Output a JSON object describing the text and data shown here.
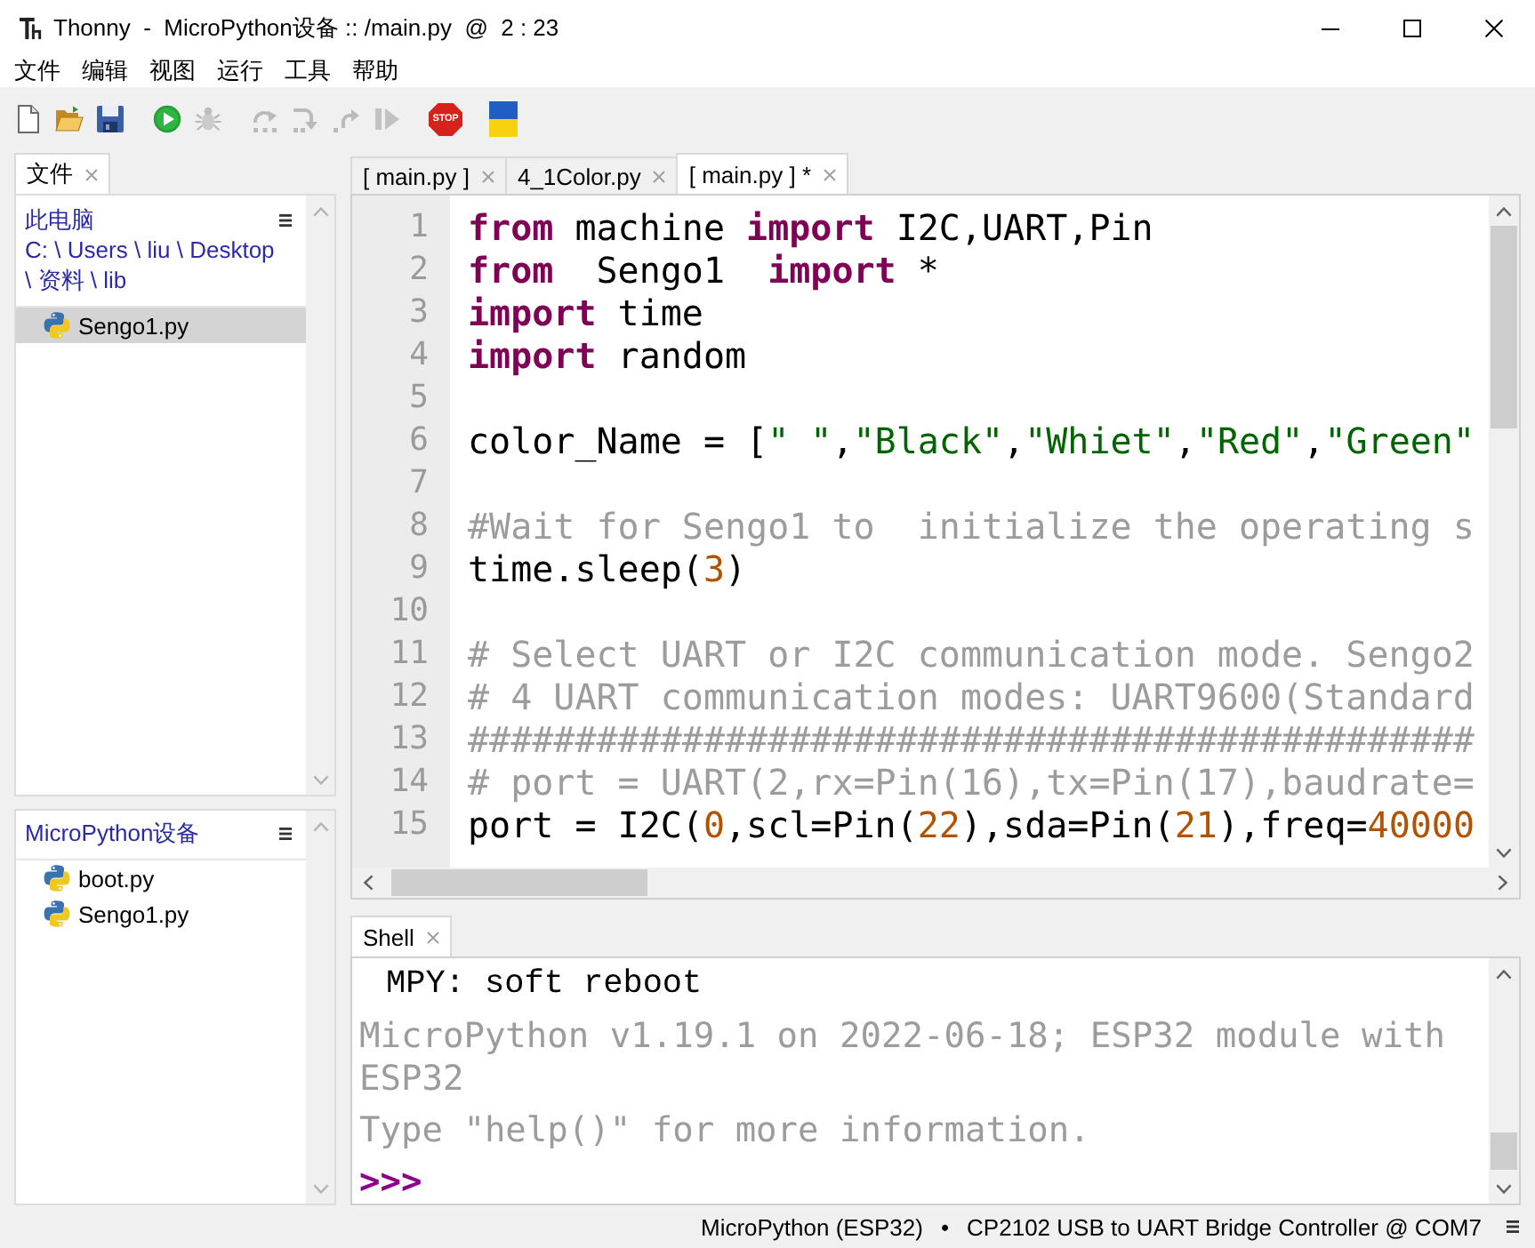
{
  "window": {
    "title": "Thonny  -  MicroPython设备 :: /main.py  @  2 : 23"
  },
  "menu": [
    "文件",
    "编辑",
    "视图",
    "运行",
    "工具",
    "帮助"
  ],
  "toolbar": [
    [
      {
        "kind": "new",
        "disabled": false
      },
      {
        "kind": "open",
        "disabled": false
      },
      {
        "kind": "save",
        "disabled": false
      }
    ],
    [
      {
        "kind": "run",
        "disabled": false
      },
      {
        "kind": "debug",
        "disabled": true
      }
    ],
    [
      {
        "kind": "step_over",
        "disabled": true
      },
      {
        "kind": "step_into",
        "disabled": true
      },
      {
        "kind": "step_out",
        "disabled": true
      },
      {
        "kind": "resume",
        "disabled": true
      }
    ],
    [
      {
        "kind": "stop",
        "label": "STOP",
        "disabled": false
      }
    ],
    [
      {
        "kind": "support",
        "disabled": false
      }
    ]
  ],
  "files_view": {
    "tab": {
      "label": "文件",
      "selected": true
    },
    "local": {
      "title": "此电脑",
      "path": [
        {
          "kind": "link",
          "text": "C:"
        },
        {
          "kind": "separator",
          "text": "\\"
        },
        {
          "kind": "link",
          "text": "Users"
        },
        {
          "kind": "separator",
          "text": "\\"
        },
        {
          "kind": "link",
          "text": "liu"
        },
        {
          "kind": "separator",
          "text": "\\"
        },
        {
          "kind": "link",
          "text": "Desktop"
        },
        {
          "kind": "separator",
          "text": "\\"
        },
        {
          "kind": "link",
          "text": "资料"
        },
        {
          "kind": "separator",
          "text": "\\"
        },
        {
          "kind": "link",
          "text": "lib"
        }
      ],
      "files": [
        {
          "name": "Sengo1.py",
          "selected": true
        }
      ]
    },
    "device": {
      "title": "MicroPython设备",
      "files": [
        {
          "name": "boot.py",
          "selected": false
        },
        {
          "name": "Sengo1.py",
          "selected": false
        }
      ]
    }
  },
  "editor": {
    "tabs": [
      {
        "label": "[ main.py ]",
        "selected": false
      },
      {
        "label": "4_1Color.py",
        "selected": false
      },
      {
        "label": "[ main.py ] *",
        "selected": true
      }
    ],
    "lines": [
      {
        "number": "1",
        "tokens": [
          {
            "kind": "keyword",
            "text": "from"
          },
          {
            "kind": "plain",
            "text": " machine "
          },
          {
            "kind": "keyword",
            "text": "import"
          },
          {
            "kind": "plain",
            "text": " I2C,UART,Pin"
          }
        ]
      },
      {
        "number": "2",
        "tokens": [
          {
            "kind": "keyword",
            "text": "from"
          },
          {
            "kind": "plain",
            "text": "  Sengo1  "
          },
          {
            "kind": "keyword",
            "text": "import"
          },
          {
            "kind": "plain",
            "text": " *"
          }
        ]
      },
      {
        "number": "3",
        "tokens": [
          {
            "kind": "keyword",
            "text": "import"
          },
          {
            "kind": "plain",
            "text": " time"
          }
        ]
      },
      {
        "number": "4",
        "tokens": [
          {
            "kind": "keyword",
            "text": "import"
          },
          {
            "kind": "plain",
            "text": " random"
          }
        ]
      },
      {
        "number": "5"
      },
      {
        "number": "6",
        "tokens": [
          {
            "kind": "plain",
            "text": "color_Name = ["
          },
          {
            "kind": "string",
            "text": "\" \""
          },
          {
            "kind": "plain",
            "text": ","
          },
          {
            "kind": "string",
            "text": "\"Black\""
          },
          {
            "kind": "plain",
            "text": ","
          },
          {
            "kind": "string",
            "text": "\"Whiet\""
          },
          {
            "kind": "plain",
            "text": ","
          },
          {
            "kind": "string",
            "text": "\"Red\""
          },
          {
            "kind": "plain",
            "text": ","
          },
          {
            "kind": "string",
            "text": "\"Green\""
          }
        ]
      },
      {
        "number": "7"
      },
      {
        "number": "8",
        "tokens": [
          {
            "kind": "comment",
            "text": "#Wait for Sengo1 to  initialize the operating s"
          }
        ]
      },
      {
        "number": "9",
        "tokens": [
          {
            "kind": "plain",
            "text": "time.sleep("
          },
          {
            "kind": "number",
            "text": "3"
          },
          {
            "kind": "plain",
            "text": ")"
          }
        ]
      },
      {
        "number": "10"
      },
      {
        "number": "11",
        "tokens": [
          {
            "kind": "comment",
            "text": "# Select UART or I2C communication mode. Sengo2"
          }
        ]
      },
      {
        "number": "12",
        "tokens": [
          {
            "kind": "comment",
            "text": "# 4 UART communication modes: UART9600(Standard"
          }
        ]
      },
      {
        "number": "13",
        "tokens": [
          {
            "kind": "comment",
            "text": "###############################################"
          }
        ]
      },
      {
        "number": "14",
        "tokens": [
          {
            "kind": "comment",
            "text": "# port = UART(2,rx=Pin(16),tx=Pin(17),baudrate="
          }
        ]
      },
      {
        "number": "15",
        "tokens": [
          {
            "kind": "plain",
            "text": "port = I2C("
          },
          {
            "kind": "number",
            "text": "0"
          },
          {
            "kind": "plain",
            "text": ",scl=Pin("
          },
          {
            "kind": "number",
            "text": "22"
          },
          {
            "kind": "plain",
            "text": "),sda=Pin("
          },
          {
            "kind": "number",
            "text": "21"
          },
          {
            "kind": "plain",
            "text": "),freq="
          },
          {
            "kind": "number",
            "text": "40000"
          }
        ]
      }
    ]
  },
  "shell": {
    "tab": {
      "label": "Shell",
      "selected": true
    },
    "lines": [
      {
        "kind": "output",
        "text": "MPY: soft reboot"
      },
      {
        "kind": "info",
        "text": "MicroPython v1.19.1 on 2022-06-18; ESP32 module with ESP32"
      },
      {
        "kind": "info",
        "text": "Type \"help()\" for more information."
      },
      {
        "kind": "prompt",
        "text": ">>>"
      }
    ]
  },
  "status_bar": {
    "interpreter": "MicroPython (ESP32)",
    "separator": "•",
    "port": "CP2102 USB to UART Bridge Controller @ COM7"
  }
}
